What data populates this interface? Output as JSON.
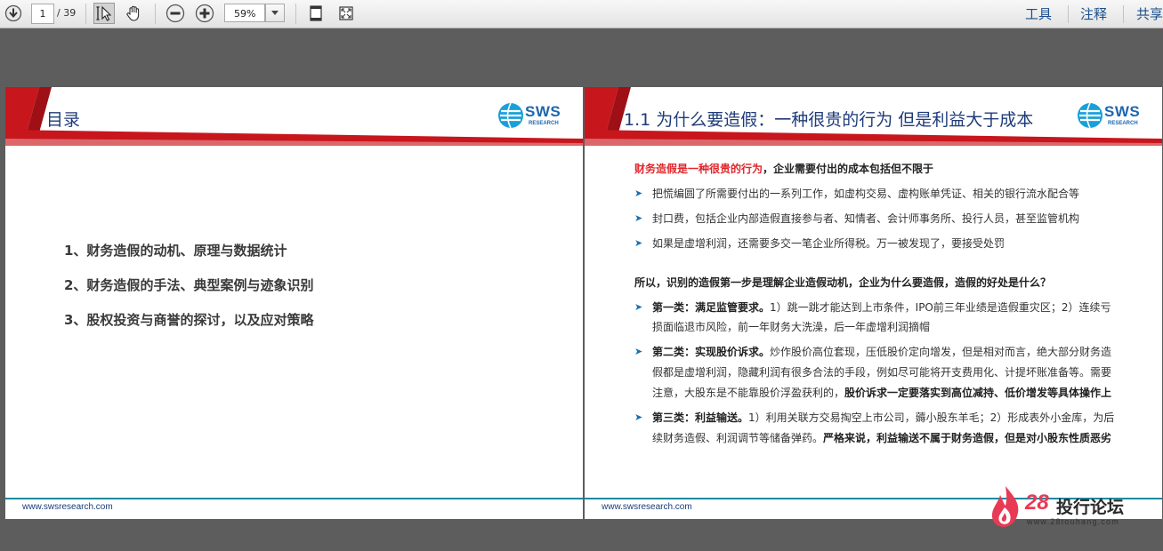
{
  "toolbar": {
    "page_current": "1",
    "page_total": "/ 39",
    "zoom": "59%",
    "menu_tools": "工具",
    "menu_comment": "注释",
    "menu_share": "共享"
  },
  "slide1": {
    "title": "目录",
    "logo": "SWS",
    "logo_sub": "RESEARCH",
    "items": [
      "1、财务造假的动机、原理与数据统计",
      "2、财务造假的手法、典型案例与迹象识别",
      "3、股权投资与商誉的探讨，以及应对策略"
    ],
    "footer": "www.swsresearch.com"
  },
  "slide2": {
    "title": "1.1  为什么要造假：一种很贵的行为  但是利益大于成本",
    "logo": "SWS",
    "logo_sub": "RESEARCH",
    "intro_red": "财务造假是一种很贵的行为",
    "intro_rest": "，企业需要付出的成本包括但不限于",
    "bullets1": [
      "把慌编圆了所需要付出的一系列工作，如虚构交易、虚构账单凭证、相关的银行流水配合等",
      "封口费，包括企业内部造假直接参与者、知情者、会计师事务所、投行人员，甚至监管机构",
      "如果是虚增利润，还需要多交一笔企业所得税。万一被发现了，要接受处罚"
    ],
    "question": "所以，识别的造假第一步是理解企业造假动机，企业为什么要造假，造假的好处是什么？",
    "cat1_bold": "第一类：满足监管要求。",
    "cat1_text1": "1）跳一跳才能达到上市条件，IPO前三年业绩是造假重灾区；2）连续亏",
    "cat1_text2": "损面临退市风险，前一年财务大洗澡，后一年虚增利润摘帽",
    "cat2_bold": "第二类：实现股价诉求。",
    "cat2_text1": "炒作股价高位套现，压低股价定向增发，但是相对而言，绝大部分财务造",
    "cat2_text2": "假都是虚增利润，隐藏利润有很多合法的手段，例如尽可能将开支费用化、计提坏账准备等。需要",
    "cat2_text3a": "注意，大股东是不能靠股价浮盈获利的，",
    "cat2_text3b": "股价诉求一定要落实到高位减持、低价增发等具体操作上",
    "cat3_bold": "第三类：利益输送。",
    "cat3_text1": "1）利用关联方交易掏空上市公司，薅小股东羊毛；2）形成表外小金库，为后",
    "cat3_text2a": "续财务造假、利润调节等储备弹药。",
    "cat3_text2b": "严格来说，利益输送不属于财务造假，但是对小股东性质恶劣",
    "footer": "www.swsresearch.com"
  },
  "watermark": {
    "num": "28",
    "name": "投行论坛",
    "url": "www.28touhang.com"
  },
  "colors": {
    "accent_red": "#c8161d",
    "title_blue": "#1f3b78",
    "logo_blue": "#1d66b0",
    "footer_teal": "#1b8aa0",
    "bg_gray": "#5d5d5d"
  }
}
